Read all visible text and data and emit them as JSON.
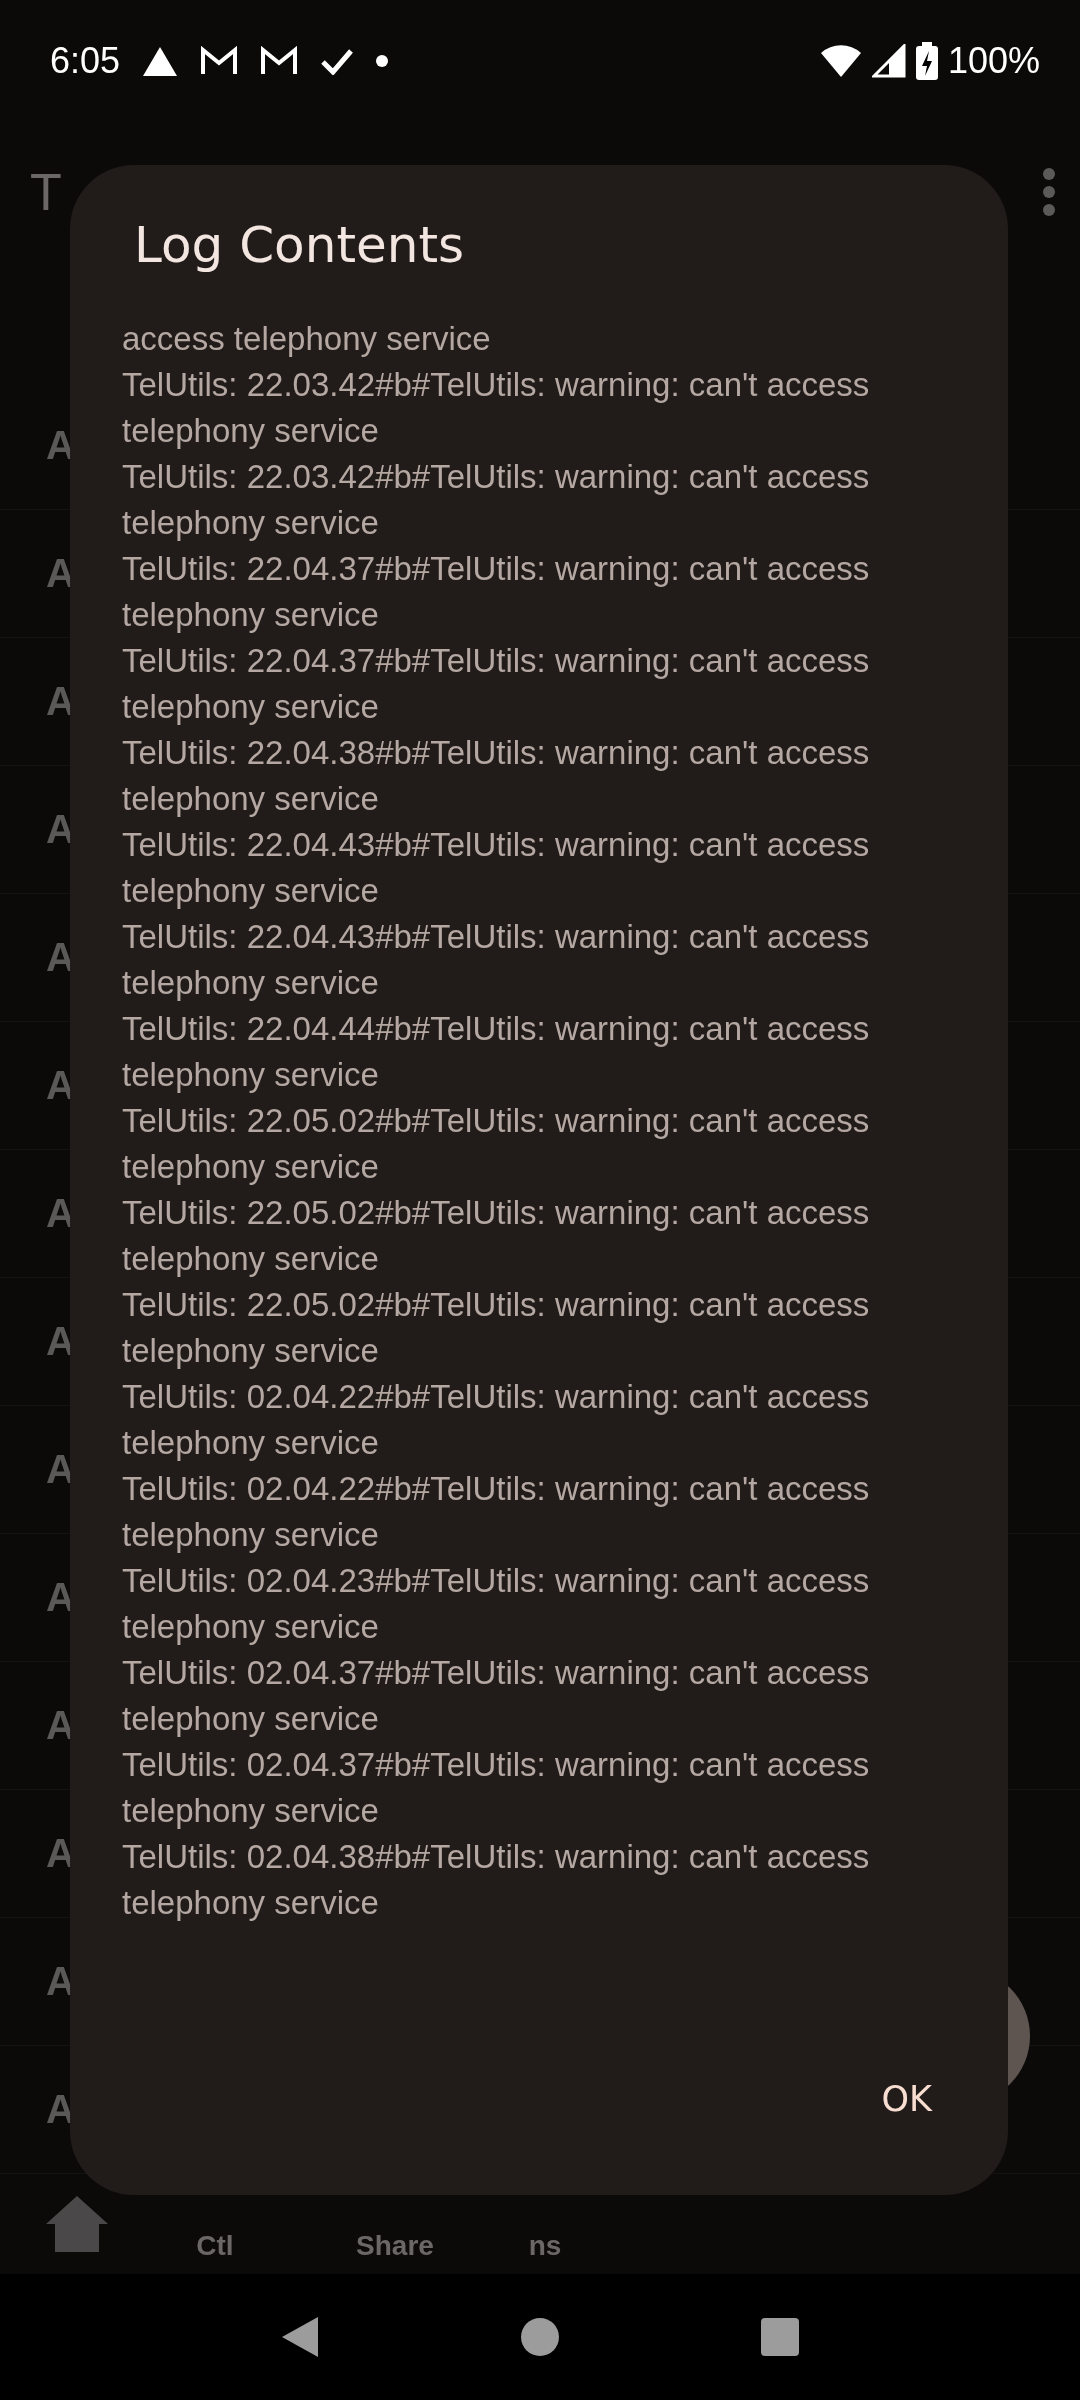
{
  "status_bar": {
    "time": "6:05",
    "battery": "100%"
  },
  "background_app": {
    "title": "T",
    "rows": [
      "A",
      "A",
      "A",
      "A",
      "A",
      "A",
      "A",
      "A",
      "A",
      "A",
      "A",
      "A",
      "A",
      "A"
    ],
    "bottom_nav": [
      "Ctl",
      "Share",
      "ns"
    ]
  },
  "dialog": {
    "title": "Log Contents",
    "log_lines": [
      "access telephony service",
      "TelUtils: 22.03.42#b#TelUtils: warning: can't access telephony service",
      "TelUtils: 22.03.42#b#TelUtils: warning: can't access telephony service",
      "TelUtils: 22.04.37#b#TelUtils: warning: can't access telephony service",
      "TelUtils: 22.04.37#b#TelUtils: warning: can't access telephony service",
      "TelUtils: 22.04.38#b#TelUtils: warning: can't access telephony service",
      "TelUtils: 22.04.43#b#TelUtils: warning: can't access telephony service",
      "TelUtils: 22.04.43#b#TelUtils: warning: can't access telephony service",
      "TelUtils: 22.04.44#b#TelUtils: warning: can't access telephony service",
      "TelUtils: 22.05.02#b#TelUtils: warning: can't access telephony service",
      "TelUtils: 22.05.02#b#TelUtils: warning: can't access telephony service",
      "TelUtils: 22.05.02#b#TelUtils: warning: can't access telephony service",
      "TelUtils: 02.04.22#b#TelUtils: warning: can't access telephony service",
      "TelUtils: 02.04.22#b#TelUtils: warning: can't access telephony service",
      "TelUtils: 02.04.23#b#TelUtils: warning: can't access telephony service",
      "TelUtils: 02.04.37#b#TelUtils: warning: can't access telephony service",
      "TelUtils: 02.04.37#b#TelUtils: warning: can't access telephony service",
      "TelUtils: 02.04.38#b#TelUtils: warning: can't access telephony service"
    ],
    "button": "OK"
  }
}
